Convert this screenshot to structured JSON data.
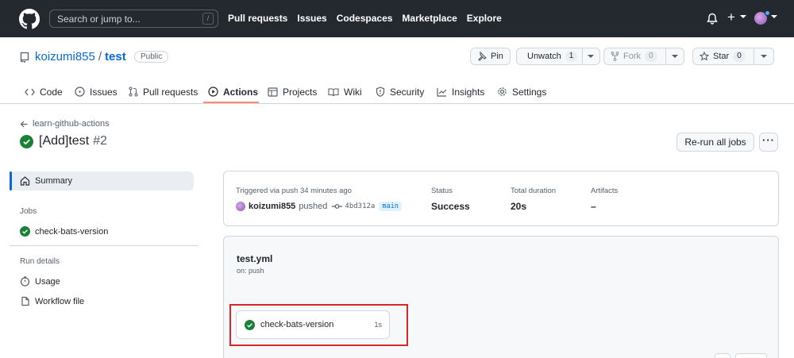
{
  "header": {
    "search_placeholder": "Search or jump to...",
    "search_shortcut": "/",
    "nav": [
      "Pull requests",
      "Issues",
      "Codespaces",
      "Marketplace",
      "Explore"
    ]
  },
  "repo": {
    "owner": "koizumi855",
    "separator": "/",
    "name": "test",
    "visibility": "Public",
    "pin_label": "Pin",
    "unwatch_label": "Unwatch",
    "unwatch_count": "1",
    "fork_label": "Fork",
    "fork_count": "0",
    "star_label": "Star",
    "star_count": "0"
  },
  "tabs": [
    {
      "label": "Code",
      "icon": "code-icon"
    },
    {
      "label": "Issues",
      "icon": "issue-icon"
    },
    {
      "label": "Pull requests",
      "icon": "pull-request-icon"
    },
    {
      "label": "Actions",
      "icon": "play-icon",
      "active": true
    },
    {
      "label": "Projects",
      "icon": "table-icon"
    },
    {
      "label": "Wiki",
      "icon": "book-icon"
    },
    {
      "label": "Security",
      "icon": "shield-icon"
    },
    {
      "label": "Insights",
      "icon": "graph-icon"
    },
    {
      "label": "Settings",
      "icon": "gear-icon"
    }
  ],
  "run": {
    "back_label": "learn-github-actions",
    "title": "[Add]test",
    "number": "#2",
    "rerun_label": "Re-run all jobs",
    "more_label": "···"
  },
  "sidebar": {
    "summary_label": "Summary",
    "jobs_heading": "Jobs",
    "job_label": "check-bats-version",
    "run_details_heading": "Run details",
    "usage_label": "Usage",
    "workflow_file_label": "Workflow file"
  },
  "summary": {
    "trigger_text": "Triggered via push 34 minutes ago",
    "actor": "koizumi855",
    "action": "pushed",
    "commit": "4bd312a",
    "branch": "main",
    "status_label": "Status",
    "status_value": "Success",
    "duration_label": "Total duration",
    "duration_value": "20s",
    "artifacts_label": "Artifacts",
    "artifacts_value": "–"
  },
  "workflow": {
    "file": "test.yml",
    "trigger": "on: push",
    "job_name": "check-bats-version",
    "job_duration": "1s"
  },
  "colors": {
    "header_bg": "#24292f",
    "link": "#0969da",
    "success": "#1a7f37",
    "active_tab_underline": "#fd8c73",
    "highlight_box": "#d62828"
  }
}
